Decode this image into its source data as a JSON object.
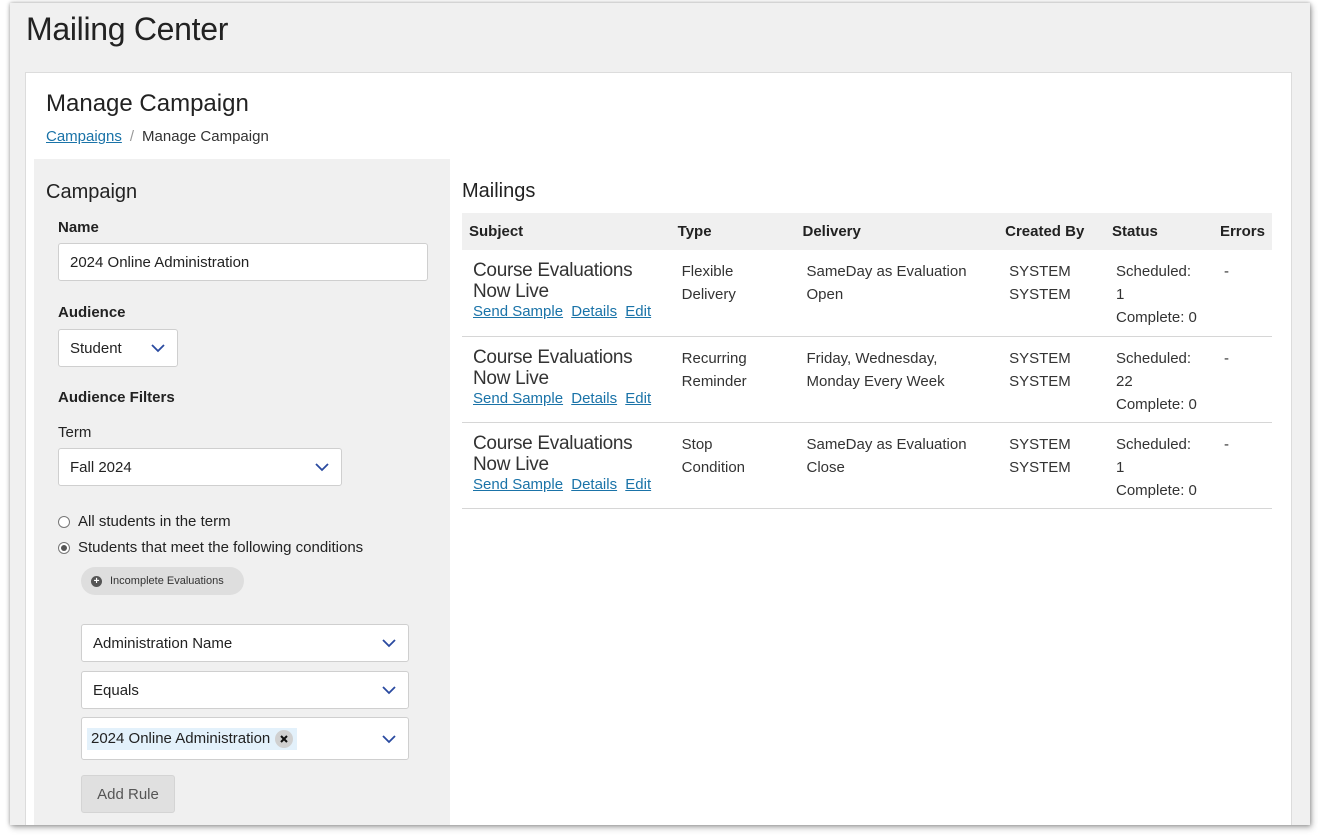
{
  "app": {
    "title": "Mailing Center"
  },
  "page": {
    "title": "Manage Campaign",
    "breadcrumb": {
      "link": "Campaigns",
      "separator": "/",
      "current": "Manage Campaign"
    }
  },
  "campaign": {
    "section_title": "Campaign",
    "name_label": "Name",
    "name_value": "2024 Online Administration",
    "audience_label": "Audience",
    "audience_value": "Student",
    "filters_label": "Audience Filters",
    "term_label": "Term",
    "term_value": "Fall 2024",
    "radio_all": "All students in the term",
    "radio_conditions": "Students that meet the following conditions",
    "condition_pill": "Incomplete Evaluations",
    "rule_field": "Administration Name",
    "rule_operator": "Equals",
    "rule_value_tag": "2024 Online Administration",
    "add_rule_label": "Add Rule"
  },
  "mailings": {
    "title": "Mailings",
    "columns": [
      "Subject",
      "Type",
      "Delivery",
      "Created By",
      "Status",
      "Errors"
    ],
    "link_labels": {
      "send_sample": "Send Sample",
      "details": "Details",
      "edit": "Edit"
    },
    "rows": [
      {
        "subject_line1": "Course Evaluations",
        "subject_line2": "Now Live",
        "type_line1": "Flexible",
        "type_line2": "Delivery",
        "delivery_line1": "SameDay as Evaluation",
        "delivery_line2": "Open",
        "created_line1": "SYSTEM",
        "created_line2": "SYSTEM",
        "status_line1": "Scheduled:",
        "status_line2": "1",
        "status_line3": "Complete: 0",
        "errors": "-"
      },
      {
        "subject_line1": "Course Evaluations",
        "subject_line2": "Now Live",
        "type_line1": "Recurring",
        "type_line2": "Reminder",
        "delivery_line1": "Friday, Wednesday,",
        "delivery_line2": "Monday Every Week",
        "created_line1": "SYSTEM",
        "created_line2": "SYSTEM",
        "status_line1": "Scheduled:",
        "status_line2": "22",
        "status_line3": "Complete: 0",
        "errors": "-"
      },
      {
        "subject_line1": "Course Evaluations",
        "subject_line2": "Now Live",
        "type_line1": "Stop",
        "type_line2": "Condition",
        "delivery_line1": "SameDay as Evaluation",
        "delivery_line2": "Close",
        "created_line1": "SYSTEM",
        "created_line2": "SYSTEM",
        "status_line1": "Scheduled:",
        "status_line2": "1",
        "status_line3": "Complete: 0",
        "errors": "-"
      }
    ]
  },
  "colors": {
    "link": "#1a73a8",
    "panel_bg": "#f0f0f0",
    "tag_bg": "#e3f1fb",
    "chevron": "#2a4aa0"
  },
  "icons": {
    "chevron": "chevron-down-icon",
    "plus": "plus-circle-icon",
    "remove": "remove-tag-icon"
  }
}
